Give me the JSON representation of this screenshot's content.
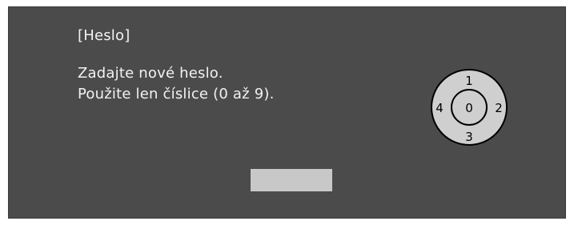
{
  "dialog": {
    "title": "[Heslo]",
    "line1": "Zadajte nové heslo.",
    "line2": "Použite len číslice (0 až 9)."
  },
  "keypad": {
    "up": "1",
    "right": "2",
    "down": "3",
    "left": "4",
    "center": "0"
  },
  "password_field": {
    "value": ""
  },
  "colors": {
    "background": "#4b4b4b",
    "text": "#f2f2f2",
    "keypad_fill": "#cfcfcf",
    "keypad_stroke": "#000000",
    "field": "#c8c8c8"
  }
}
